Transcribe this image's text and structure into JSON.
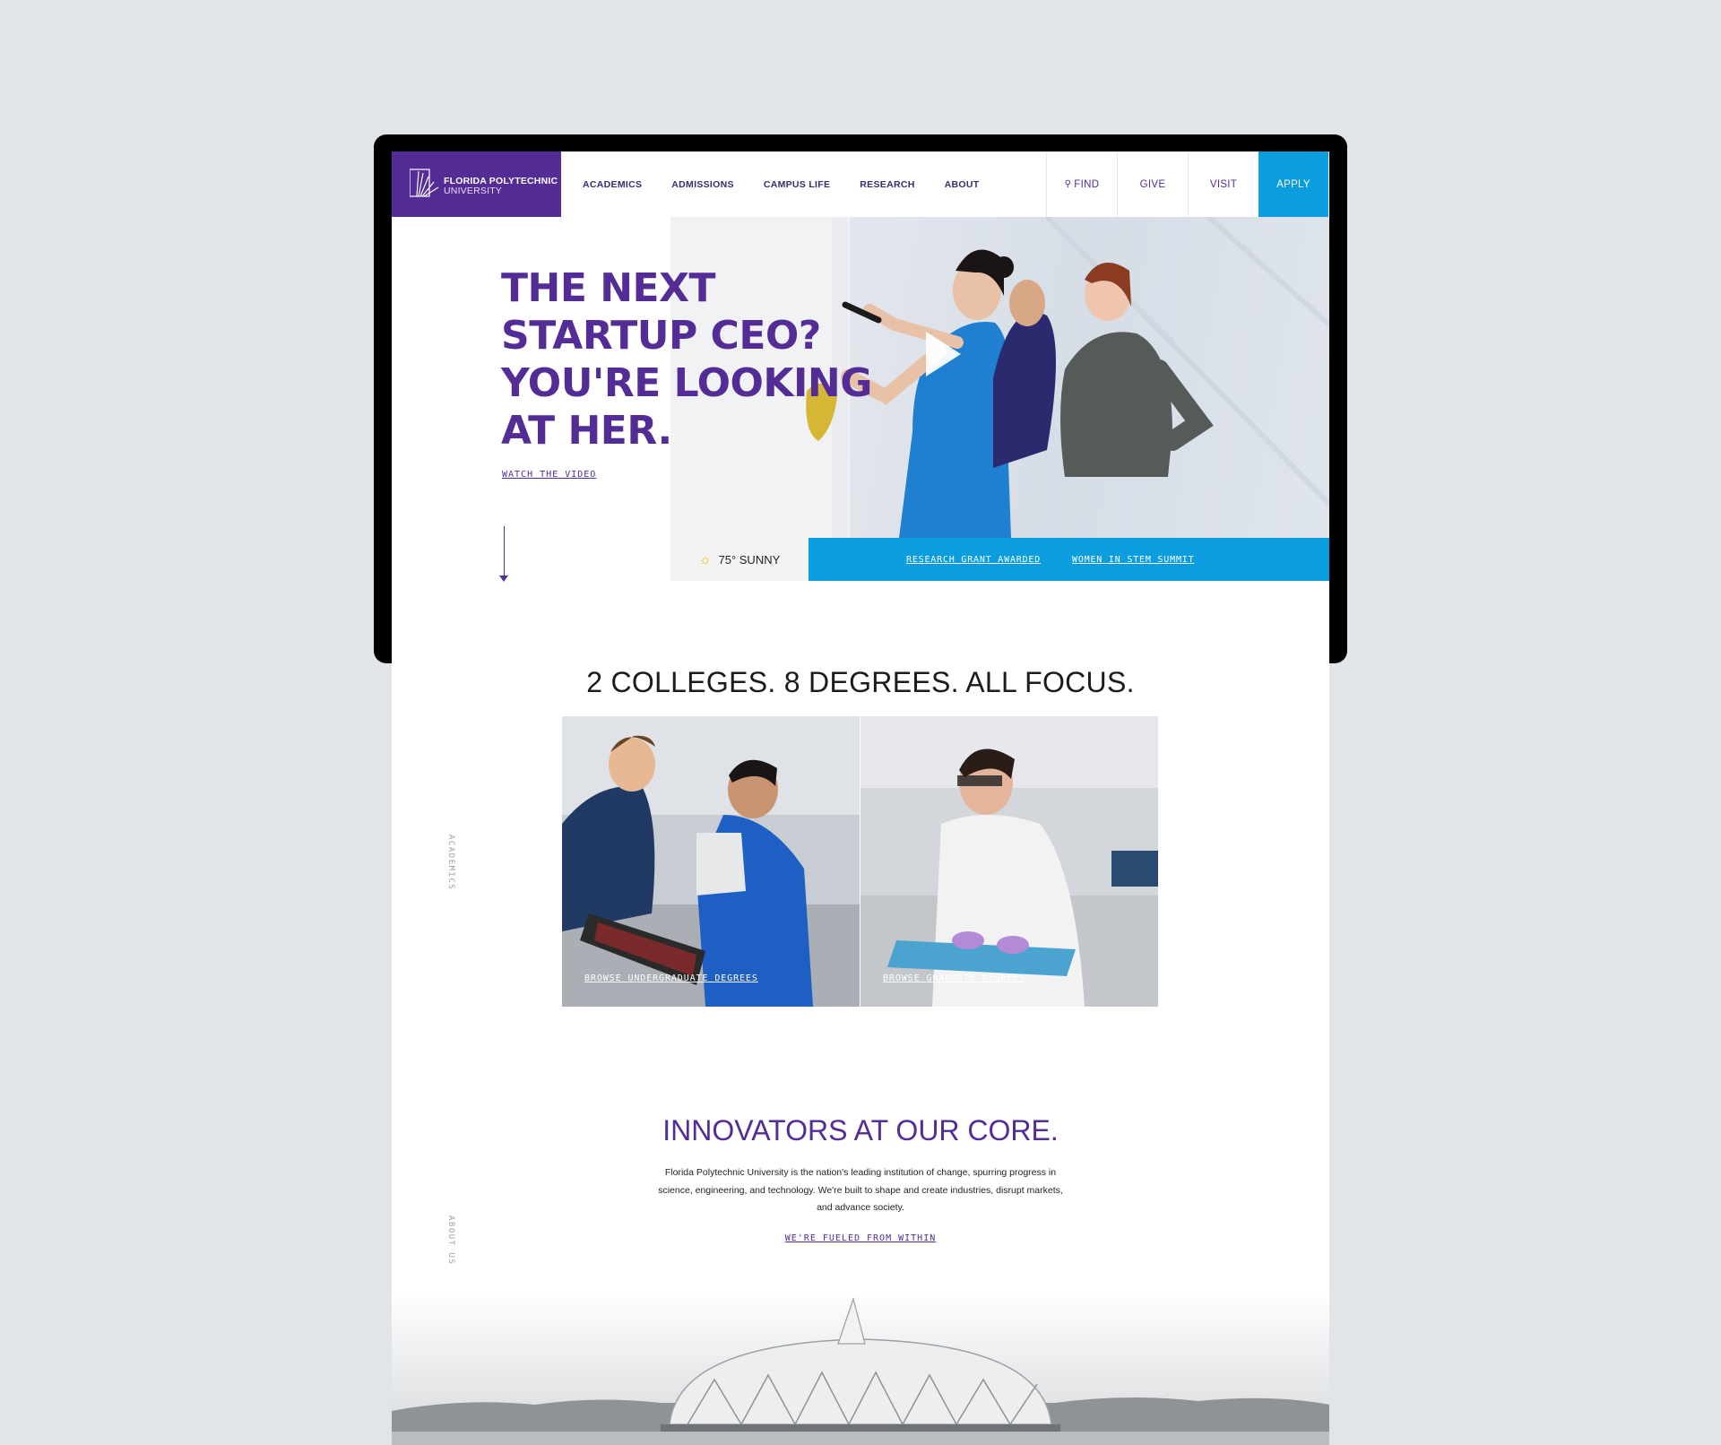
{
  "logo": {
    "line1": "FLORIDA POLYTECHNIC",
    "line2": "UNIVERSITY"
  },
  "nav": {
    "items": [
      "ACADEMICS",
      "ADMISSIONS",
      "CAMPUS LIFE",
      "RESEARCH",
      "ABOUT"
    ],
    "find": "FIND",
    "give": "GIVE",
    "visit": "VISIT",
    "apply": "APPLY"
  },
  "hero": {
    "headline": [
      "THE NEXT",
      "STARTUP CEO?",
      "YOU'RE LOOKING",
      "AT HER."
    ],
    "cta": "WATCH THE VIDEO"
  },
  "weather": {
    "text": "75° SUNNY"
  },
  "news": [
    "RESEARCH GRANT AWARDED",
    "WOMEN IN STEM SUMMIT"
  ],
  "academics": {
    "side_label": "ACADEMICS",
    "title": "2 COLLEGES. 8 DEGREES. ALL FOCUS.",
    "tiles": [
      "BROWSE UNDERGRADUATE DEGREES",
      "BROWSE GRADUATE DEGREES"
    ]
  },
  "about": {
    "side_label": "ABOUT US",
    "title": "INNOVATORS AT OUR CORE.",
    "body": "Florida Polytechnic University is the nation's leading institution of change, spurring progress in science, engineering, and technology. We're built to shape and create industries, disrupt markets, and advance society.",
    "link": "WE'RE FUELED FROM WITHIN"
  },
  "colors": {
    "purple": "#542c96",
    "blue": "#0c9ddf"
  }
}
